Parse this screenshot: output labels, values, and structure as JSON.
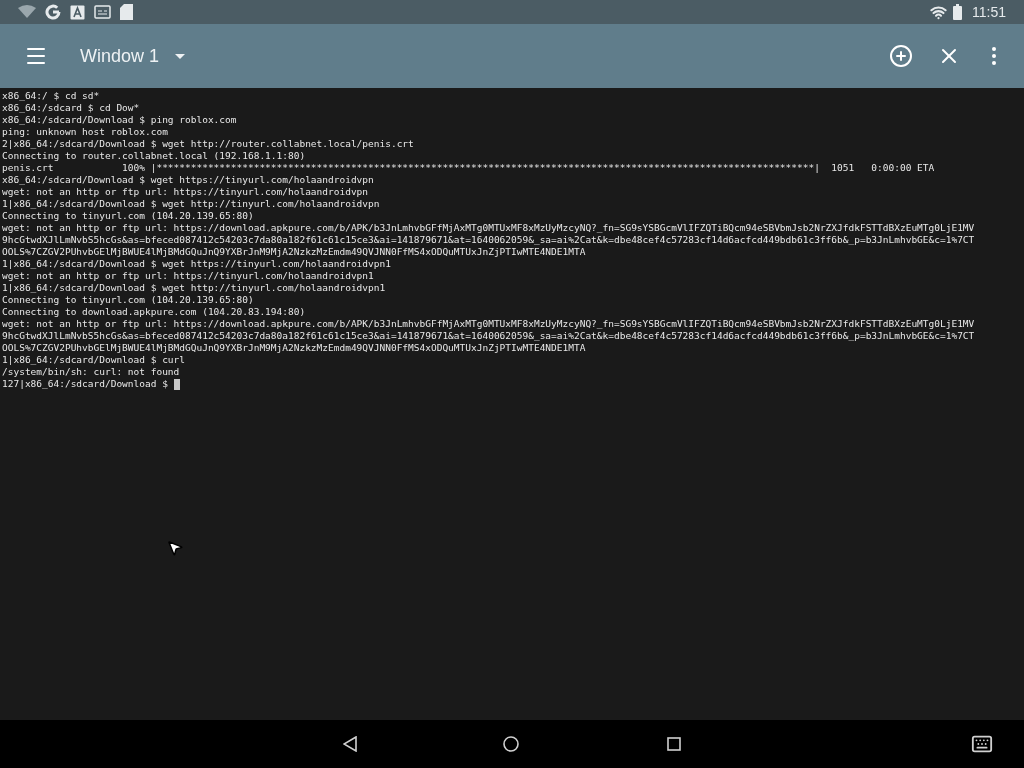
{
  "status_bar": {
    "time": "11:51"
  },
  "toolbar": {
    "window_title": "Window 1"
  },
  "terminal": {
    "lines": [
      "x86_64:/ $ cd sd*",
      "x86_64:/sdcard $ cd Dow*",
      "x86_64:/sdcard/Download $ ping roblox.com",
      "ping: unknown host roblox.com",
      "2|x86_64:/sdcard/Download $ wget http://router.collabnet.local/penis.crt",
      "Connecting to router.collabnet.local (192.168.1.1:80)",
      "penis.crt            100% |*******************************************************************************************************************|  1051   0:00:00 ETA",
      "x86_64:/sdcard/Download $ wget https://tinyurl.com/holaandroidvpn",
      "wget: not an http or ftp url: https://tinyurl.com/holaandroidvpn",
      "1|x86_64:/sdcard/Download $ wget http://tinyurl.com/holaandroidvpn",
      "Connecting to tinyurl.com (104.20.139.65:80)",
      "wget: not an http or ftp url: https://download.apkpure.com/b/APK/b3JnLmhvbGFfMjAxMTg0MTUxMF8xMzUyMzcyNQ?_fn=SG9sYSBGcmVlIFZQTiBQcm94eSBVbmJsb2NrZXJfdkFSTTdBXzEuMTg0LjE1MV",
      "9hcGtwdXJlLmNvbS5hcGs&as=bfeced087412c54203c7da80a182f61c61c15ce3&ai=141879671&at=1640062059&_sa=ai%2Cat&k=dbe48cef4c57283cf14d6acfcd449bdb61c3ff6b&_p=b3JnLmhvbGE&c=1%7CT",
      "OOLS%7CZGV2PUhvbGElMjBWUE4lMjBMdGQuJnQ9YXBrJnM9MjA2NzkzMzEmdm49QVJNN0FfMS4xODQuMTUxJnZjPTIwMTE4NDE1MTA",
      "1|x86_64:/sdcard/Download $ wget https://tinyurl.com/holaandroidvpn1",
      "wget: not an http or ftp url: https://tinyurl.com/holaandroidvpn1",
      "1|x86_64:/sdcard/Download $ wget http://tinyurl.com/holaandroidvpn1",
      "Connecting to tinyurl.com (104.20.139.65:80)",
      "Connecting to download.apkpure.com (104.20.83.194:80)",
      "wget: not an http or ftp url: https://download.apkpure.com/b/APK/b3JnLmhvbGFfMjAxMTg0MTUxMF8xMzUyMzcyNQ?_fn=SG9sYSBGcmVlIFZQTiBQcm94eSBVbmJsb2NrZXJfdkFSTTdBXzEuMTg0LjE1MV",
      "9hcGtwdXJlLmNvbS5hcGs&as=bfeced087412c54203c7da80a182f61c61c15ce3&ai=141879671&at=1640062059&_sa=ai%2Cat&k=dbe48cef4c57283cf14d6acfcd449bdb61c3ff6b&_p=b3JnLmhvbGE&c=1%7CT",
      "OOLS%7CZGV2PUhvbGElMjBWUE4lMjBMdGQuJnQ9YXBrJnM9MjA2NzkzMzEmdm49QVJNN0FfMS4xODQuMTUxJnZjPTIwMTE4NDE1MTA",
      "1|x86_64:/sdcard/Download $ curl",
      "/system/bin/sh: curl: not found",
      "127|x86_64:/sdcard/Download $ "
    ],
    "cursor": true
  }
}
